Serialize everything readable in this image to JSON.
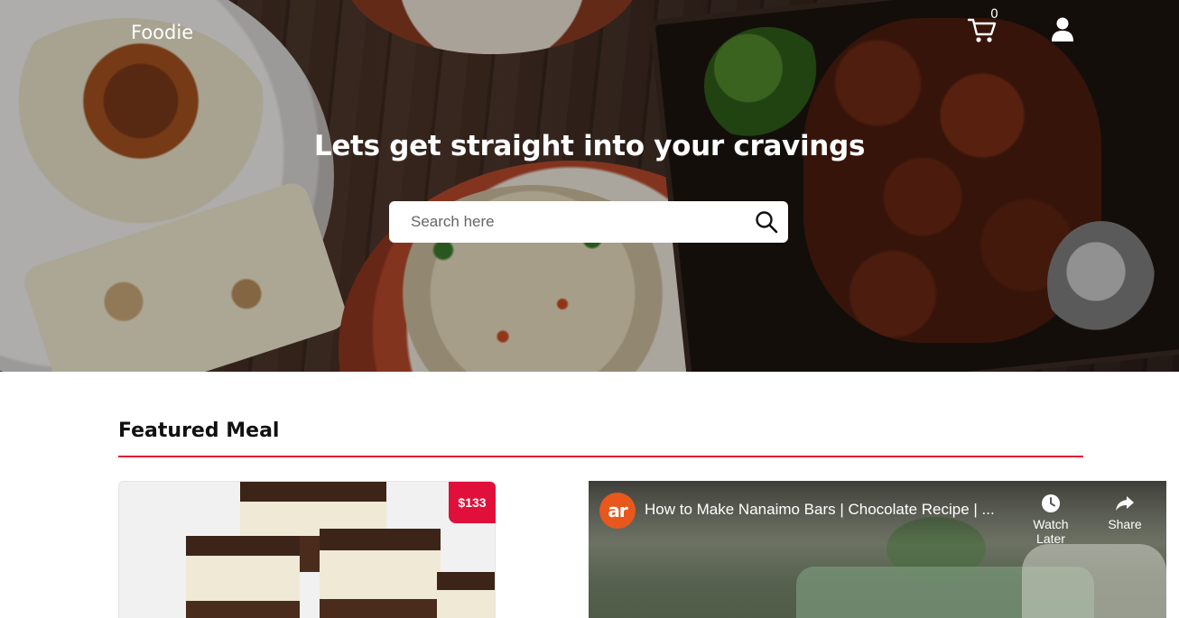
{
  "header": {
    "brand": "Foodie",
    "cart_count": "0",
    "icons": [
      "cart-icon",
      "user-icon"
    ]
  },
  "hero": {
    "title": "Lets get straight into your cravings",
    "search_placeholder": "Search here",
    "search_value": ""
  },
  "featured": {
    "section_title": "Featured Meal",
    "accent_color": "#e0103a",
    "meal": {
      "price": "$133"
    },
    "video": {
      "channel_logo": "ar",
      "title": "How to Make Nanaimo Bars | Chocolate Recipe | ...",
      "actions": [
        {
          "label": "Watch Later",
          "icon": "clock-icon"
        },
        {
          "label": "Share",
          "icon": "share-icon"
        }
      ]
    }
  }
}
